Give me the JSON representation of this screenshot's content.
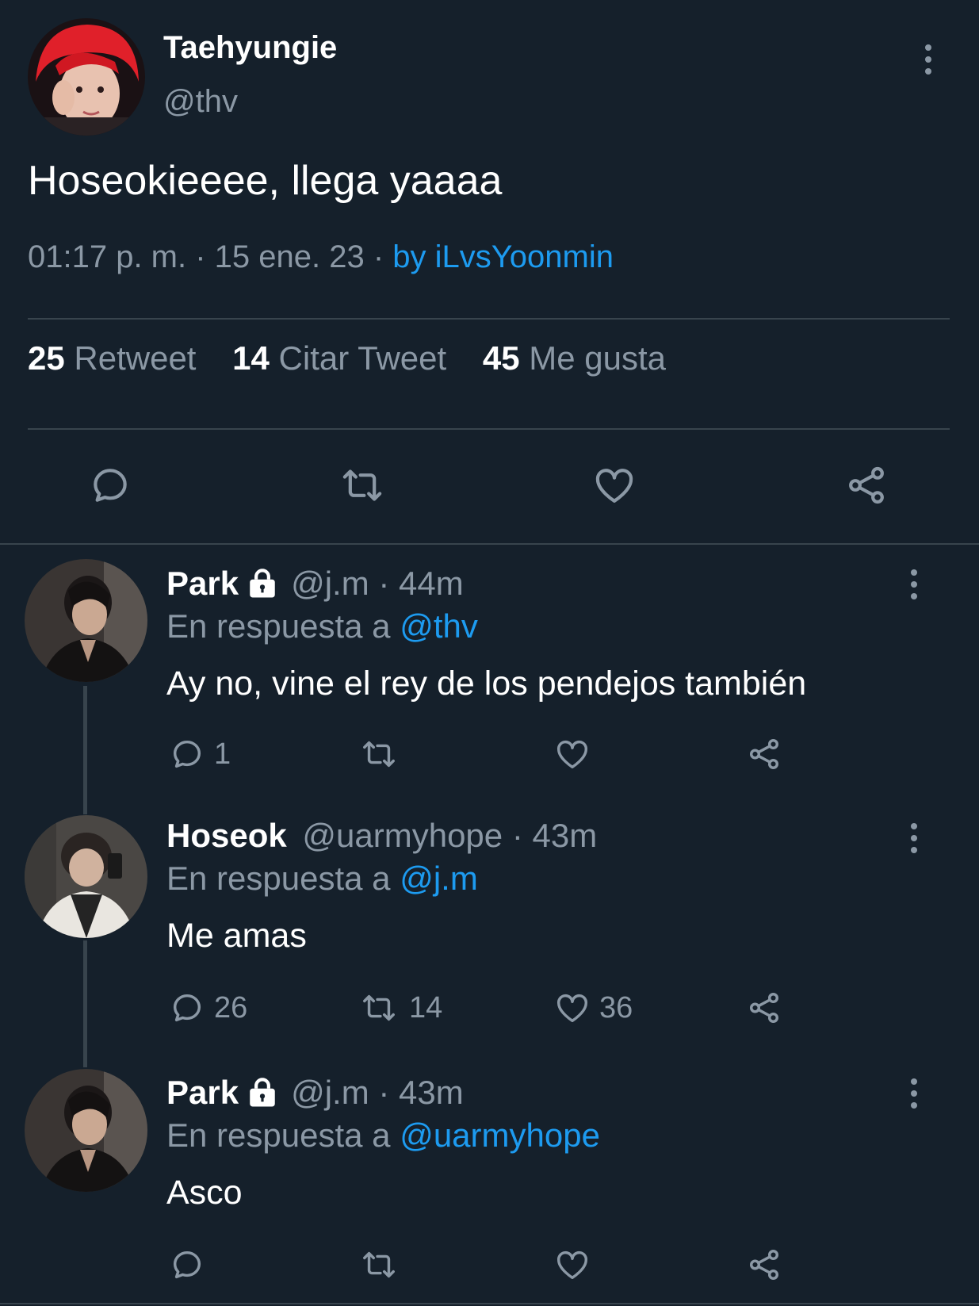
{
  "main_tweet": {
    "display_name": "Taehyungie",
    "handle": "@thv",
    "text": "Hoseokieeee, llega yaaaa",
    "time": "01:17 p. m. · 15 ene. 23 ·",
    "source": "by iLvsYoonmin",
    "stats": {
      "retweets_count": "25",
      "retweets_label": "Retweet",
      "quotes_count": "14",
      "quotes_label": "Citar Tweet",
      "likes_count": "45",
      "likes_label": "Me gusta"
    }
  },
  "replies": [
    {
      "display_name": "Park",
      "handle_time": "@j.m · 44m",
      "reply_prefix": "En respuesta a",
      "reply_to": "@thv",
      "text": "Ay no, vine el rey de los pendejos también",
      "reply_count": "1",
      "retweet_count": "",
      "like_count": ""
    },
    {
      "display_name": "Hoseok",
      "handle_time": "@uarmyhope · 43m",
      "reply_prefix": "En respuesta a",
      "reply_to": "@j.m",
      "text": "Me amas",
      "reply_count": "26",
      "retweet_count": "14",
      "like_count": "36"
    },
    {
      "display_name": "Park",
      "handle_time": "@j.m · 43m",
      "reply_prefix": "En respuesta a",
      "reply_to": "@uarmyhope",
      "text": "Asco",
      "reply_count": "",
      "retweet_count": "",
      "like_count": ""
    }
  ],
  "icons": {
    "reply": "speech-bubble-icon",
    "retweet": "retweet-icon",
    "like": "heart-icon",
    "share": "share-icon",
    "more": "vertical-dots-icon",
    "lock": "lock-icon"
  },
  "colors": {
    "background": "#15202b",
    "text": "#ffffff",
    "muted": "#8b98a5",
    "accent": "#1d9bf0",
    "divider": "#38444d"
  }
}
